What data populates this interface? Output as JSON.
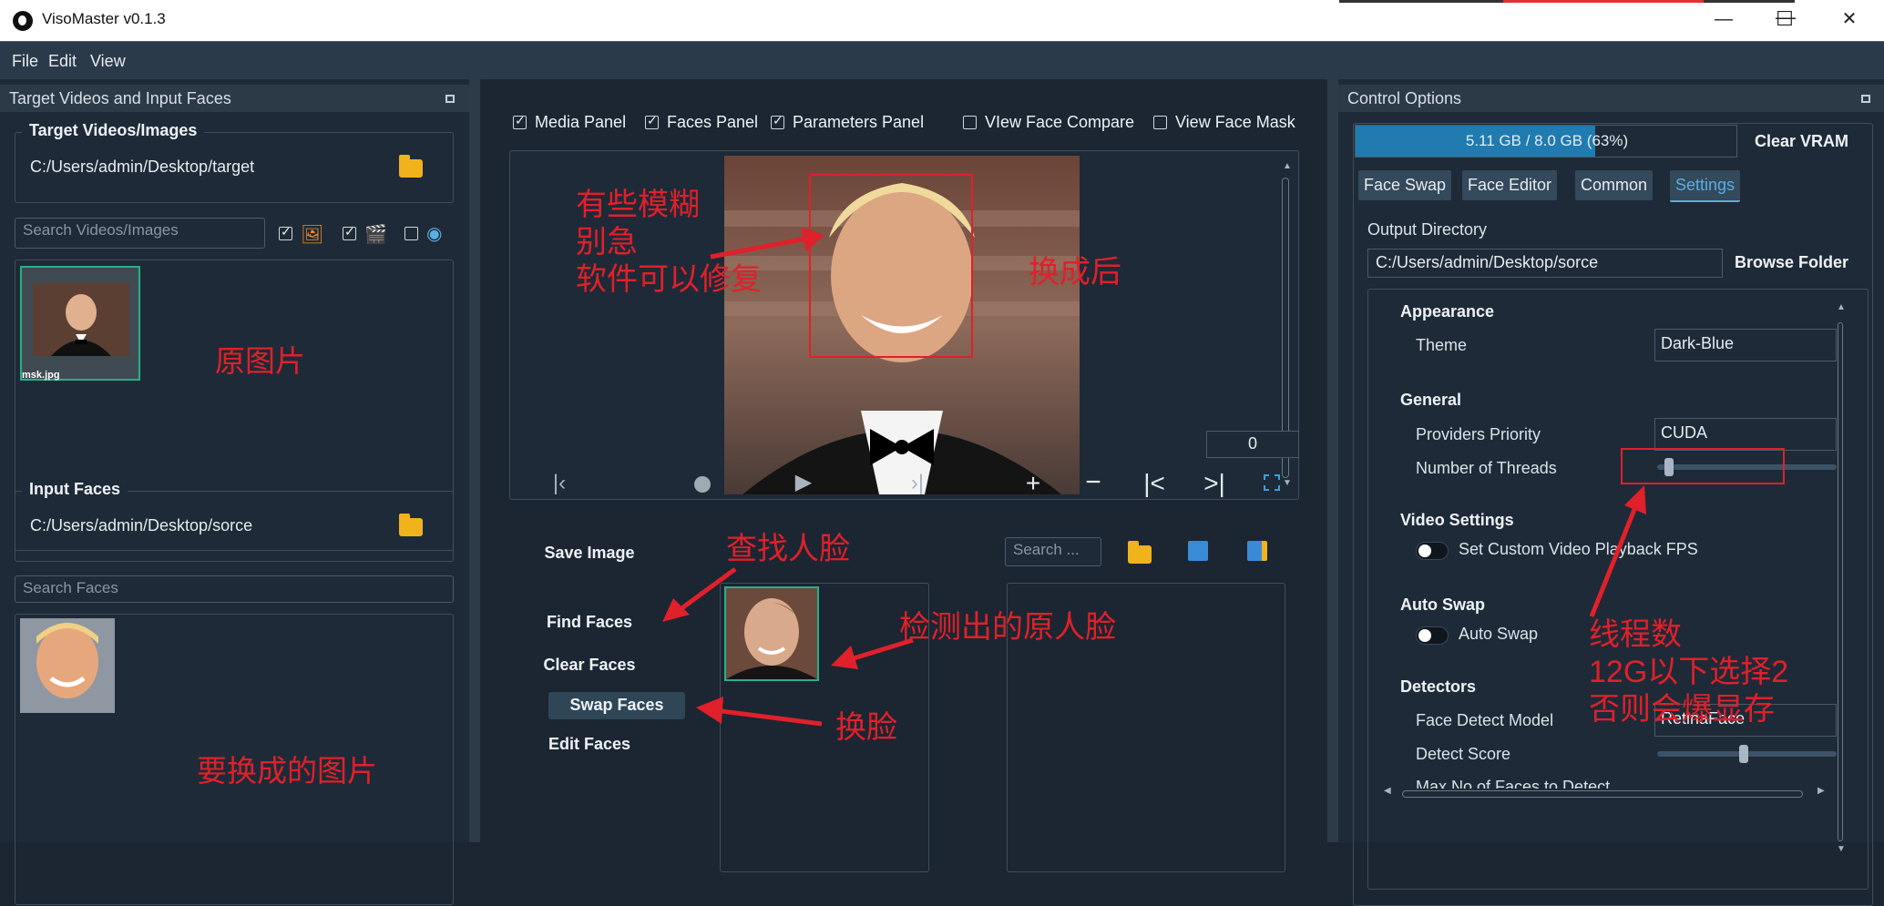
{
  "window": {
    "title": "VisoMaster v0.1.3",
    "min": "—",
    "max": "☐",
    "close": "✕"
  },
  "menu": [
    "File",
    "Edit",
    "View"
  ],
  "left_panel": {
    "title": "Target Videos and Input Faces",
    "target_group": {
      "title": "Target Videos/Images",
      "path": "C:/Users/admin/Desktop/target"
    },
    "search_videos_placeholder": "Search Videos/Images",
    "thumb_label": "msk.jpg",
    "input_group": {
      "title": "Input Faces",
      "path": "C:/Users/admin/Desktop/sorce"
    },
    "search_faces_placeholder": "Search Faces",
    "note_original": "原图片",
    "note_target_face": "要换成的图片"
  },
  "center": {
    "toggles": [
      {
        "label": "Media Panel",
        "checked": true
      },
      {
        "label": "Faces Panel",
        "checked": true
      },
      {
        "label": "Parameters Panel",
        "checked": true
      },
      {
        "label": "VIew Face Compare",
        "checked": false
      },
      {
        "label": "View Face Mask",
        "checked": false
      }
    ],
    "frame_number": "0",
    "buttons": {
      "save": "Save Image",
      "find": "Find Faces",
      "clear": "Clear Faces",
      "swap": "Swap Faces",
      "edit": "Edit Faces"
    },
    "search_placeholder": "Search ...",
    "note_blurry": "有些模糊\n别急\n软件可以修复",
    "note_after": "换成后",
    "note_find": "查找人脸",
    "note_detected": "检测出的原人脸",
    "note_swap": "换脸"
  },
  "right_panel": {
    "title": "Control Options",
    "vram": {
      "text": "5.11 GB / 8.0 GB (63%)",
      "fraction": 0.63,
      "clear_label": "Clear VRAM"
    },
    "tabs": [
      "Face Swap",
      "Face Editor",
      "Common",
      "Settings"
    ],
    "active_tab": "Settings",
    "output_dir_label": "Output Directory",
    "output_dir": "C:/Users/admin/Desktop/sorce",
    "browse_label": "Browse Folder",
    "sections": {
      "appearance": "Appearance",
      "theme_label": "Theme",
      "theme_value": "Dark-Blue",
      "general": "General",
      "providers_label": "Providers Priority",
      "providers_value": "CUDA",
      "threads_label": "Number of Threads",
      "video": "Video Settings",
      "fps_label": "Set Custom Video Playback FPS",
      "autoswap": "Auto Swap",
      "autoswap_label": "Auto Swap",
      "detectors": "Detectors",
      "detect_model_label": "Face Detect Model",
      "detect_model_value": "RetinaFace",
      "detect_score_label": "Detect Score",
      "max_faces_label": "Max No of Faces to Detect"
    },
    "note_threads": "线程数\n12G以下选择2\n否则会爆显存"
  },
  "colors": {
    "accent": "#5aaee0",
    "annotation": "#e0202a",
    "vram_fill": "#1f7bb0"
  }
}
